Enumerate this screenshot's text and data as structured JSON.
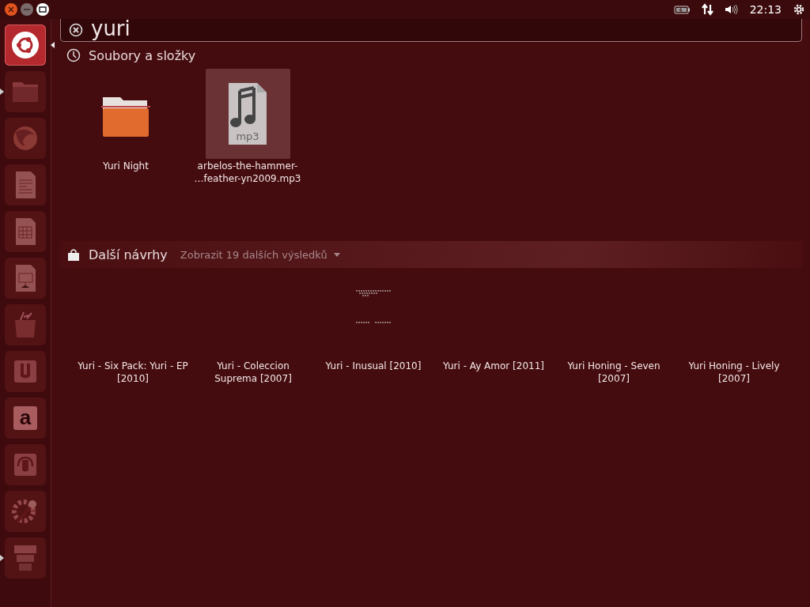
{
  "panel": {
    "clock": "22:13"
  },
  "launcher": [
    {
      "kind": "dash",
      "selected": true,
      "running": false
    },
    {
      "kind": "folder",
      "selected": false,
      "running": true
    },
    {
      "kind": "browser",
      "selected": false,
      "running": false
    },
    {
      "kind": "writer",
      "selected": false,
      "running": false
    },
    {
      "kind": "calc",
      "selected": false,
      "running": false
    },
    {
      "kind": "impress",
      "selected": false,
      "running": false
    },
    {
      "kind": "bag",
      "selected": false,
      "running": false
    },
    {
      "kind": "cloud",
      "selected": false,
      "running": false
    },
    {
      "kind": "amazon",
      "glyph": "a",
      "selected": false,
      "running": false
    },
    {
      "kind": "music",
      "selected": false,
      "running": false
    },
    {
      "kind": "settings",
      "selected": false,
      "running": false
    },
    {
      "kind": "workspaces",
      "selected": false,
      "running": true
    }
  ],
  "search": {
    "value": "yuri"
  },
  "sections": [
    {
      "kind": "files",
      "title": "Soubory a složky",
      "items": [
        {
          "kind": "folder",
          "label": "Yuri Night",
          "selected": false
        },
        {
          "kind": "mp3",
          "label": "arbelos-the-hammer-\n…feather-yn2009.mp3",
          "selected": true
        }
      ]
    },
    {
      "kind": "shop",
      "title": "Další návrhy",
      "more": "Zobrazit 19 dalších výsledků",
      "items": [
        {
          "kind": "album",
          "label": "Yuri - Six Pack: Yuri - EP [2010]"
        },
        {
          "kind": "album",
          "label": "Yuri - Coleccion Suprema [2007]"
        },
        {
          "kind": "album",
          "label": "Yuri - Inusual [2010]"
        },
        {
          "kind": "album",
          "label": "Yuri - Ay Amor [2011]"
        },
        {
          "kind": "album",
          "label": "Yuri Honing - Seven [2007]"
        },
        {
          "kind": "album",
          "label": "Yuri Honing - Lively [2007]"
        }
      ]
    }
  ]
}
